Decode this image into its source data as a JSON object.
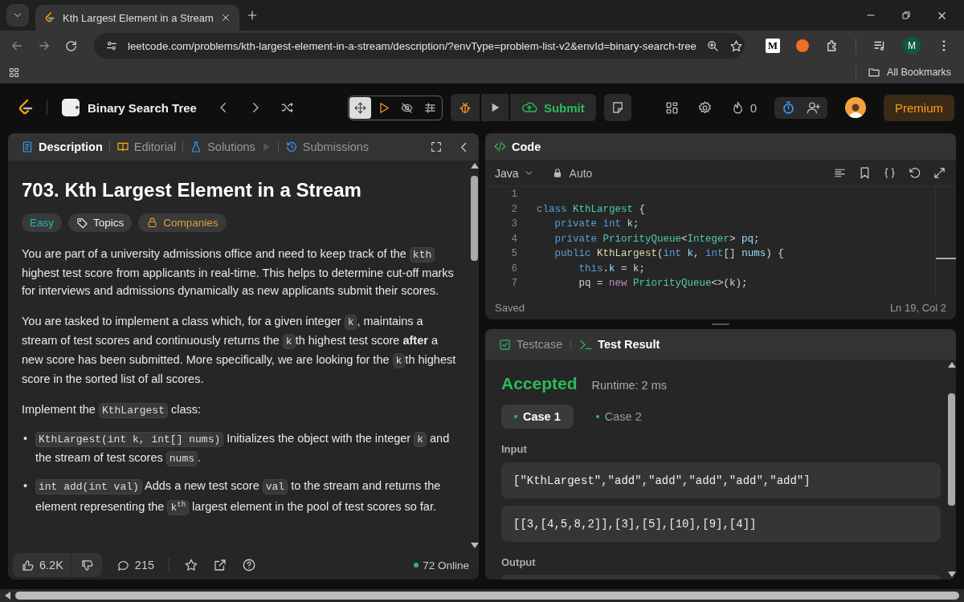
{
  "browser": {
    "tab_title": "Kth Largest Element in a Stream",
    "url": "leetcode.com/problems/kth-largest-element-in-a-stream/description/?envType=problem-list-v2&envId=binary-search-tree",
    "extension_letter": "M",
    "profile_initial": "M",
    "bookmarks_label": "All Bookmarks"
  },
  "header": {
    "problem_list": "Binary Search Tree",
    "layout_tools": [
      {
        "kind": "move",
        "selected": true
      },
      {
        "kind": "play",
        "selected": false
      },
      {
        "kind": "hide",
        "selected": false
      },
      {
        "kind": "sliders",
        "selected": false
      }
    ],
    "submit": "Submit",
    "streak": "0",
    "premium": "Premium"
  },
  "description": {
    "tabs": [
      {
        "label": "Description",
        "kind": "doc",
        "selected": true
      },
      {
        "label": "Editorial",
        "kind": "book",
        "selected": false
      },
      {
        "label": "Solutions",
        "kind": "flask",
        "selected": false
      },
      {
        "label": "Submissions",
        "kind": "history",
        "selected": false
      }
    ],
    "title": "703. Kth Largest Element in a Stream",
    "tags": [
      {
        "label": "Easy",
        "kind": "difficulty"
      },
      {
        "label": "Topics",
        "kind": "topics"
      },
      {
        "label": "Companies",
        "kind": "companies"
      }
    ],
    "paragraphs": [
      {
        "kind": "paragraph",
        "parts": [
          {
            "kind": "text",
            "text": "You are part of a university admissions office and need to keep track of the "
          },
          {
            "kind": "code",
            "text": "kth"
          },
          {
            "kind": "text",
            "text": " highest test score from applicants in real-time. This helps to determine cut-off marks for interviews and admissions dynamically as new applicants submit their scores."
          }
        ]
      },
      {
        "kind": "paragraph",
        "parts": [
          {
            "kind": "text",
            "text": "You are tasked to implement a class which, for a given integer "
          },
          {
            "kind": "code",
            "text": "k"
          },
          {
            "kind": "text",
            "text": ", maintains a stream of test scores and continuously returns the "
          },
          {
            "kind": "code",
            "text": "k"
          },
          {
            "kind": "text",
            "text": "th highest test score **after** a new score has been submitted. More specifically, we are looking for the "
          },
          {
            "kind": "code",
            "text": "k"
          },
          {
            "kind": "text",
            "text": "th highest score in the sorted list of all scores."
          }
        ]
      },
      {
        "kind": "paragraph",
        "parts": [
          {
            "kind": "text",
            "text": "Implement the "
          },
          {
            "kind": "code",
            "text": "KthLargest"
          },
          {
            "kind": "text",
            "text": " class:"
          }
        ]
      },
      {
        "kind": "bullet",
        "marker": "•",
        "parts": [
          {
            "kind": "code",
            "text": "KthLargest(int k, int[] nums)"
          },
          {
            "kind": "text",
            "text": " Initializes the object with the integer "
          },
          {
            "kind": "code",
            "text": "k"
          },
          {
            "kind": "text",
            "text": " and the stream of test scores "
          },
          {
            "kind": "code",
            "text": "nums"
          },
          {
            "kind": "text",
            "text": "."
          }
        ]
      },
      {
        "kind": "bullet",
        "marker": "•",
        "parts": [
          {
            "kind": "code",
            "text": "int add(int val)"
          },
          {
            "kind": "text",
            "text": " Adds a new test score "
          },
          {
            "kind": "code",
            "text": "val"
          },
          {
            "kind": "text",
            "text": " to the stream and returns the element representing the "
          },
          {
            "kind": "code",
            "text": "k$^{th}$"
          },
          {
            "kind": "text",
            "text": " largest element in the pool of test scores so far."
          }
        ]
      }
    ],
    "likes": "6.2K",
    "comments": "215",
    "online": "72 Online"
  },
  "editor": {
    "title": "Code",
    "language": "Java",
    "mode": "Auto",
    "lines": [
      {
        "number": "1"
      },
      {
        "number": "2",
        "tokens": [
          {
            "kind": "keyword",
            "text": "class "
          },
          {
            "kind": "type",
            "text": "KthLargest"
          },
          {
            "kind": "plain",
            "text": " {"
          }
        ]
      },
      {
        "number": "3",
        "tokens": [
          {
            "kind": "keyword",
            "text": "   private int "
          },
          {
            "kind": "variable",
            "text": "k"
          },
          {
            "kind": "plain",
            "text": ";"
          }
        ]
      },
      {
        "number": "4",
        "tokens": [
          {
            "kind": "keyword",
            "text": "   private "
          },
          {
            "kind": "type",
            "text": "PriorityQueue"
          },
          {
            "kind": "plain",
            "text": "<"
          },
          {
            "kind": "type",
            "text": "Integer"
          },
          {
            "kind": "plain",
            "text": "> "
          },
          {
            "kind": "variable",
            "text": "pq"
          },
          {
            "kind": "plain",
            "text": ";"
          }
        ]
      },
      {
        "number": "5",
        "tokens": [
          {
            "kind": "keyword",
            "text": "   public "
          },
          {
            "kind": "function",
            "text": "KthLargest"
          },
          {
            "kind": "plain",
            "text": "("
          },
          {
            "kind": "keyword",
            "text": "int "
          },
          {
            "kind": "variable",
            "text": "k"
          },
          {
            "kind": "plain",
            "text": ", "
          },
          {
            "kind": "keyword",
            "text": "int"
          },
          {
            "kind": "plain",
            "text": "[] "
          },
          {
            "kind": "variable",
            "text": "nums"
          },
          {
            "kind": "plain",
            "text": ") {"
          }
        ]
      },
      {
        "number": "6",
        "tokens": [
          {
            "kind": "keyword",
            "text": "       this"
          },
          {
            "kind": "plain",
            "text": "."
          },
          {
            "kind": "variable",
            "text": "k"
          },
          {
            "kind": "plain",
            "text": " = k;"
          }
        ]
      },
      {
        "number": "7",
        "tokens": [
          {
            "kind": "plain",
            "text": "       pq = "
          },
          {
            "kind": "control",
            "text": "new "
          },
          {
            "kind": "type",
            "text": "PriorityQueue"
          },
          {
            "kind": "plain",
            "text": "<>(k);"
          }
        ]
      }
    ],
    "status": "Saved",
    "cursor": "Ln 19, Col 2"
  },
  "results": {
    "tabs": [
      {
        "label": "Testcase",
        "kind": "checkbox",
        "selected": false
      },
      {
        "label": "Test Result",
        "kind": "terminal",
        "selected": true
      }
    ],
    "verdict": "Accepted",
    "runtime": "Runtime: 2 ms",
    "cases": [
      {
        "label": "Case 1",
        "passed": true,
        "selected": true
      },
      {
        "label": "Case 2",
        "passed": true,
        "selected": false
      }
    ],
    "input_label": "Input",
    "inputs": [
      "[\"KthLargest\",\"add\",\"add\",\"add\",\"add\",\"add\"]",
      "[[3,[4,5,8,2]],[3],[5],[10],[9],[4]]"
    ],
    "output_label": "Output"
  }
}
